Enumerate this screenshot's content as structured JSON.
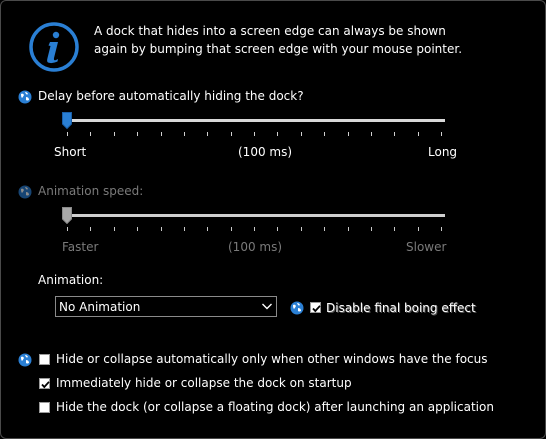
{
  "info": {
    "text_line1": "A dock that hides into a screen edge can always be shown",
    "text_line2": "again by bumping that screen edge with your mouse pointer."
  },
  "delay": {
    "label": "Delay before automatically hiding the dock?",
    "min_label": "Short",
    "mid_label": "(100 ms)",
    "max_label": "Long",
    "value_fraction": 0.0,
    "enabled": true
  },
  "animation_speed": {
    "label": "Animation speed:",
    "min_label": "Faster",
    "mid_label": "(100 ms)",
    "max_label": "Slower",
    "value_fraction": 0.0,
    "enabled": false
  },
  "animation": {
    "label": "Animation:",
    "selected": "No Animation"
  },
  "boing": {
    "label": "Disable final boing effect",
    "checked": true
  },
  "options": [
    {
      "label": "Hide or collapse automatically only when other windows have the focus",
      "checked": false
    },
    {
      "label": "Immediately hide or collapse the dock on startup",
      "checked": true
    },
    {
      "label": "Hide the dock (or collapse a floating dock) after launching an application",
      "checked": false
    }
  ],
  "colors": {
    "accent": "#2a7fd4",
    "background": "#000000",
    "text": "#ffffff",
    "disabled_text": "#7a7a7a"
  },
  "icons": {
    "info": "info-icon",
    "help": "globe-help-icon",
    "dropdown": "chevron-down-icon",
    "check": "checkmark-icon"
  }
}
